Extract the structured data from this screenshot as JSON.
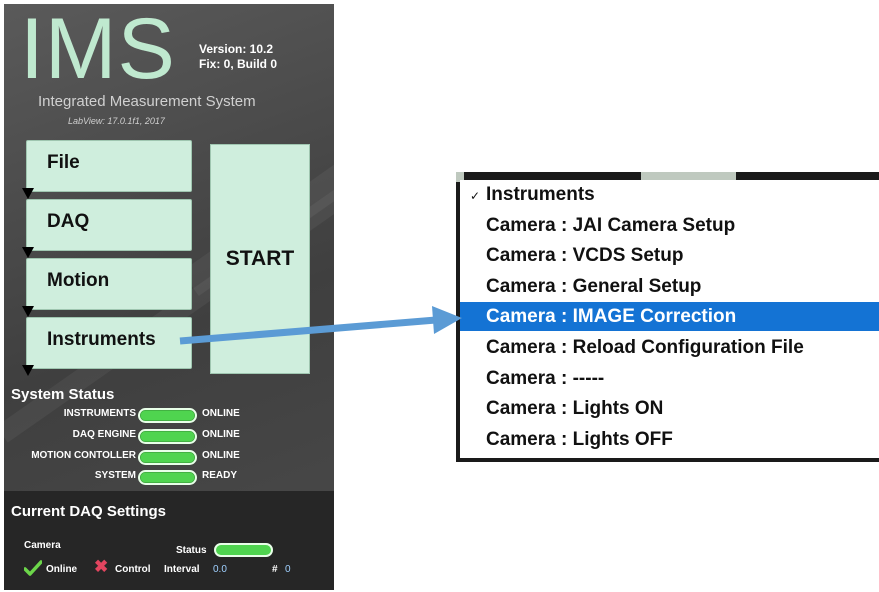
{
  "app": {
    "logo": "IMS",
    "version": "Version: 10.2",
    "fix": "Fix: 0, Build 0",
    "subtitle": "Integrated Measurement System",
    "labview": "LabView: 17.0.1f1, 2017"
  },
  "menu": [
    {
      "label": "File"
    },
    {
      "label": "DAQ"
    },
    {
      "label": "Motion"
    },
    {
      "label": "Instruments"
    }
  ],
  "start_label": "START",
  "system_status": {
    "title": "System Status",
    "rows": [
      {
        "name": "INSTRUMENTS",
        "value": "ONLINE"
      },
      {
        "name": "DAQ ENGINE",
        "value": "ONLINE"
      },
      {
        "name": "MOTION CONTOLLER",
        "value": "ONLINE"
      },
      {
        "name": "SYSTEM",
        "value": "READY"
      }
    ],
    "led_color": "#4fd44f"
  },
  "daq_settings": {
    "title": "Current DAQ Settings",
    "camera_label": "Camera",
    "status_label": "Status",
    "online_label": "Online",
    "control_label": "Control",
    "interval_label": "Interval",
    "interval_value": "0.0",
    "hash_label": "#",
    "hash_value": "0"
  },
  "dropdown": {
    "checkmark": "✓",
    "items": [
      {
        "label": "Instruments",
        "checked": true
      },
      {
        "label": "Camera :  JAI Camera Setup"
      },
      {
        "label": "Camera :  VCDS Setup"
      },
      {
        "label": "Camera :  General Setup"
      },
      {
        "label": "Camera :  IMAGE Correction",
        "selected": true
      },
      {
        "label": "Camera :  Reload Configuration File"
      },
      {
        "label": "Camera :  -----"
      },
      {
        "label": "Camera :  Lights ON"
      },
      {
        "label": "Camera :  Lights OFF"
      }
    ],
    "highlight_color": "#1473d4"
  },
  "arrow_color": "#5b9bd5"
}
